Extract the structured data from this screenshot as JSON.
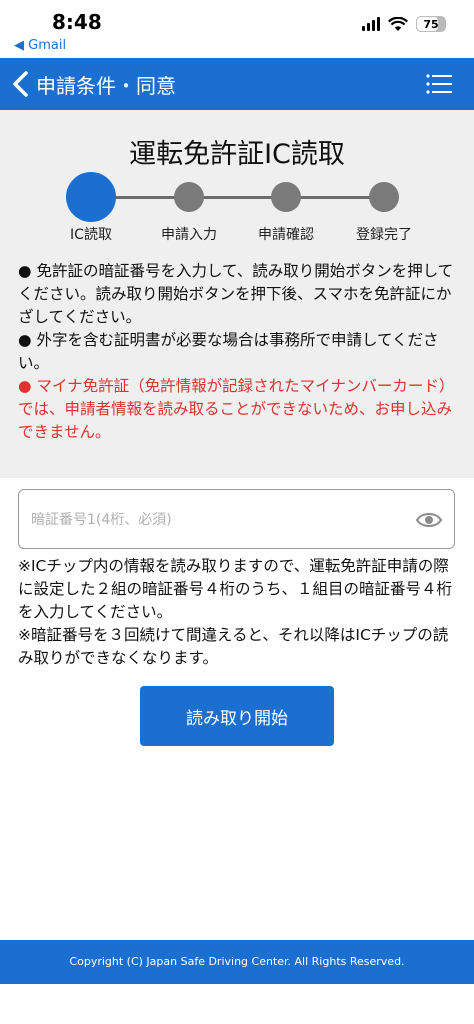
{
  "status_bar": {
    "time": "8:48",
    "back_app": "◀ Gmail",
    "battery": "75"
  },
  "header": {
    "title": "申請条件・同意",
    "back_icon": "chevron-left-icon",
    "menu_icon": "hamburger-menu-icon"
  },
  "page": {
    "title": "運転免許証IC読取"
  },
  "steps": [
    {
      "label": "IC読取",
      "active": true
    },
    {
      "label": "申請入力",
      "active": false
    },
    {
      "label": "申請確認",
      "active": false
    },
    {
      "label": "登録完了",
      "active": false
    }
  ],
  "instructions": [
    "● 免許証の暗証番号を入力して、読み取り開始ボタンを押してください。読み取り開始ボタンを押下後、スマホを免許証にかざしてください。",
    "● 外字を含む証明書が必要な場合は事務所で申請してください。",
    "● マイナ免許証（免許情報が記録されたマイナンバーカード）では、申請者情報を読み取ることができないため、お申し込みできません。"
  ],
  "pin_field": {
    "value": "",
    "placeholder": "暗証番号1(4桁、必須)"
  },
  "notes": [
    "※ICチップ内の情報を読み取りますので、運転免許証申請の際に設定した２組の暗証番号４桁のうち、１組目の暗証番号４桁を入力してください。",
    "※暗証番号を３回続けて間違えると、それ以降はICチップの読み取りができなくなります。"
  ],
  "start_button": "読み取り開始",
  "footer": "Copyright (C) Japan Safe Driving Center. All Rights Reserved.",
  "colors": {
    "primary": "#1b6fd1",
    "warning": "#e0322f",
    "panel": "#efefef"
  }
}
